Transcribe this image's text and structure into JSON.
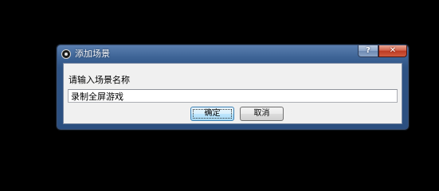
{
  "dialog": {
    "title": "添加场景",
    "icon": "obs-icon",
    "help_label": "?",
    "close_label": "✕",
    "prompt": "请输入场景名称",
    "input_value": "录制全屏游戏",
    "ok_label": "确定",
    "cancel_label": "取消"
  },
  "colors": {
    "desktop": "#000000",
    "titlebar": "#3f6597",
    "close": "#c13c24",
    "client": "#f0f0f0"
  }
}
